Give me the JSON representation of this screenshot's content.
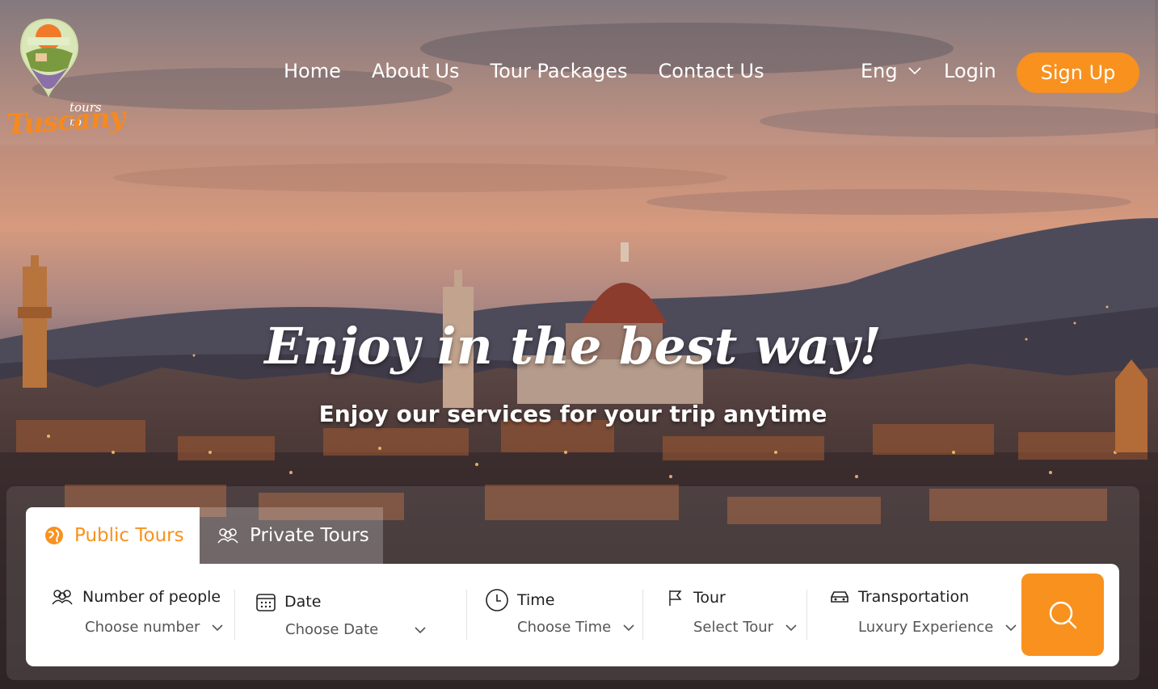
{
  "brand": {
    "logo_small": "tours to",
    "logo_big": "Tuscany",
    "accent_color": "#f8911e"
  },
  "nav": {
    "items": [
      {
        "label": "Home"
      },
      {
        "label": "About Us"
      },
      {
        "label": "Tour Packages"
      },
      {
        "label": "Contact Us"
      }
    ],
    "language": "Eng",
    "login": "Login",
    "signup": "Sign Up"
  },
  "hero": {
    "headline": "Enjoy in the best way!",
    "subline": "Enjoy our services for your trip anytime"
  },
  "search": {
    "tabs": [
      {
        "label": "Public Tours",
        "icon": "globe-icon",
        "active": true
      },
      {
        "label": "Private Tours",
        "icon": "group-icon",
        "active": false
      }
    ],
    "fields": [
      {
        "label": "Number of people",
        "value": "Choose number",
        "icon": "people-icon"
      },
      {
        "label": "Date",
        "value": "Choose Date",
        "icon": "calendar-icon"
      },
      {
        "label": "Time",
        "value": "Choose Time",
        "icon": "clock-icon"
      },
      {
        "label": "Tour",
        "value": "Select Tour",
        "icon": "flag-icon"
      },
      {
        "label": "Transportation",
        "value": "Luxury Experience",
        "icon": "car-icon"
      }
    ],
    "button_icon": "search-icon"
  }
}
